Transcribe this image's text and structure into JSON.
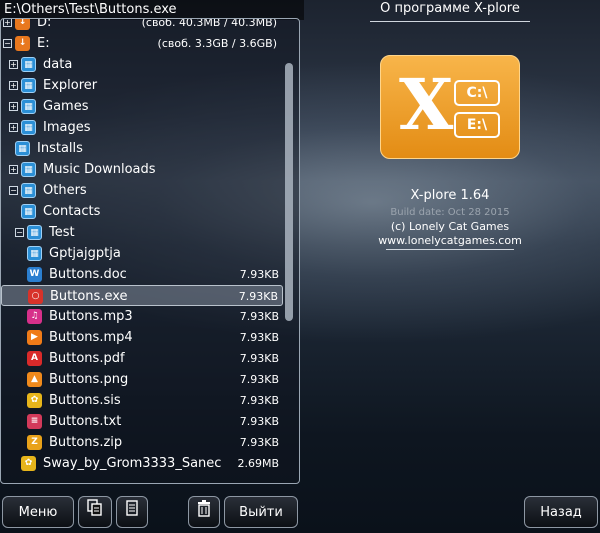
{
  "left_pane": {
    "path": "E:\\Others\\Test\\Buttons.exe",
    "rows": [
      {
        "name": "D:",
        "size": "(своб. 40.3MB / 40.3MB)",
        "kind": "drive",
        "exp": "+",
        "indent": 0
      },
      {
        "name": "E:",
        "size": "(своб. 3.3GB / 3.6GB)",
        "kind": "drive",
        "exp": "−",
        "indent": 0
      },
      {
        "name": "data",
        "size": "",
        "kind": "folder",
        "exp": "+",
        "indent": 1
      },
      {
        "name": "Explorer",
        "size": "",
        "kind": "folder",
        "exp": "+",
        "indent": 1
      },
      {
        "name": "Games",
        "size": "",
        "kind": "folder",
        "exp": "+",
        "indent": 1
      },
      {
        "name": "Images",
        "size": "",
        "kind": "folder",
        "exp": "+",
        "indent": 1
      },
      {
        "name": "Installs",
        "size": "",
        "kind": "folder",
        "exp": "",
        "indent": 1
      },
      {
        "name": "Music Downloads",
        "size": "",
        "kind": "folder",
        "exp": "+",
        "indent": 1
      },
      {
        "name": "Others",
        "size": "",
        "kind": "folder",
        "exp": "−",
        "indent": 1
      },
      {
        "name": "Contacts",
        "size": "",
        "kind": "folder",
        "exp": "",
        "indent": 2
      },
      {
        "name": "Test",
        "size": "",
        "kind": "folder",
        "exp": "−",
        "indent": 2
      },
      {
        "name": "Gptjajgptja",
        "size": "",
        "kind": "folder",
        "exp": "",
        "indent": 3
      },
      {
        "name": "Buttons.doc",
        "size": "7.93KB",
        "kind": "doc",
        "exp": "",
        "indent": 3
      },
      {
        "name": "Buttons.exe",
        "size": "7.93KB",
        "kind": "exe",
        "exp": "",
        "indent": 3,
        "selected": true
      },
      {
        "name": "Buttons.mp3",
        "size": "7.93KB",
        "kind": "mp3",
        "exp": "",
        "indent": 3
      },
      {
        "name": "Buttons.mp4",
        "size": "7.93KB",
        "kind": "mp4",
        "exp": "",
        "indent": 3
      },
      {
        "name": "Buttons.pdf",
        "size": "7.93KB",
        "kind": "pdf",
        "exp": "",
        "indent": 3
      },
      {
        "name": "Buttons.png",
        "size": "7.93KB",
        "kind": "png",
        "exp": "",
        "indent": 3
      },
      {
        "name": "Buttons.sis",
        "size": "7.93KB",
        "kind": "sis",
        "exp": "",
        "indent": 3
      },
      {
        "name": "Buttons.txt",
        "size": "7.93KB",
        "kind": "txt",
        "exp": "",
        "indent": 3
      },
      {
        "name": "Buttons.zip",
        "size": "7.93KB",
        "kind": "zip",
        "exp": "",
        "indent": 3
      },
      {
        "name": "Sway_by_Grom3333_Sanec",
        "size": "2.69MB",
        "kind": "sis",
        "exp": "",
        "indent": 2
      }
    ]
  },
  "buttons": {
    "menu": "Меню",
    "exit": "Выйти",
    "back": "Назад"
  },
  "about": {
    "title": "О программе X-plore",
    "logo_c": "C:\\",
    "logo_e": "E:\\",
    "version": "X-plore 1.64",
    "build_date": "Build date: Oct 28 2015",
    "copyright": "(c) Lonely Cat Games",
    "website": "www.lonelycatgames.com"
  },
  "icon_colors": {
    "folder": "#2b8fd6",
    "drive": "#e8781e",
    "doc": "#2b7fd0",
    "exe": "#d8322a",
    "mp3": "#d7308a",
    "mp4": "#f07b18",
    "pdf": "#d92a2a",
    "png": "#f08a1c",
    "sis": "#e7b51b",
    "txt": "#d33a5a",
    "zip": "#e9a21a"
  }
}
